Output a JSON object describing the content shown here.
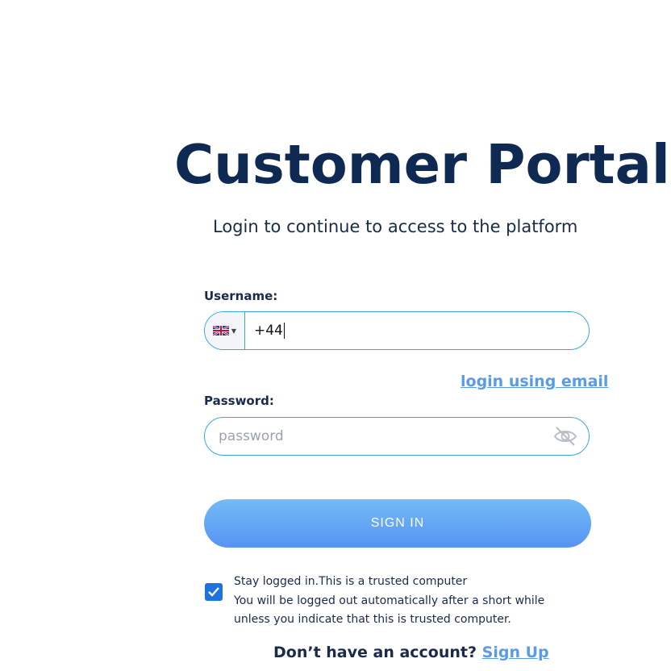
{
  "header": {
    "title": "Customer Portal",
    "subtitle": "Login to continue to access to the platform"
  },
  "form": {
    "username_label": "Username:",
    "username_country_flag": "uk-flag-icon",
    "username_value": "+44",
    "login_email_link": "login using email",
    "password_label": "Password:",
    "password_placeholder": "password",
    "password_toggle_icon": "eye-slash-icon",
    "signin_label": "SIGN IN",
    "stay_logged_in_checked": true,
    "stay_logged_in_lines": [
      "Stay logged in.This is a trusted computer",
      "You will be logged out automatically after a short while",
      "unless you indicate that this is trusted computer."
    ]
  },
  "footer": {
    "prompt": "Don’t have an account?",
    "signup_link": "Sign Up"
  },
  "colors": {
    "title": "#0f2a52",
    "field_border": "#38a8dd",
    "link": "#5a9be6",
    "button_top": "#72bcf7",
    "button_bottom": "#5793f2",
    "checkbox": "#1f73dc"
  }
}
